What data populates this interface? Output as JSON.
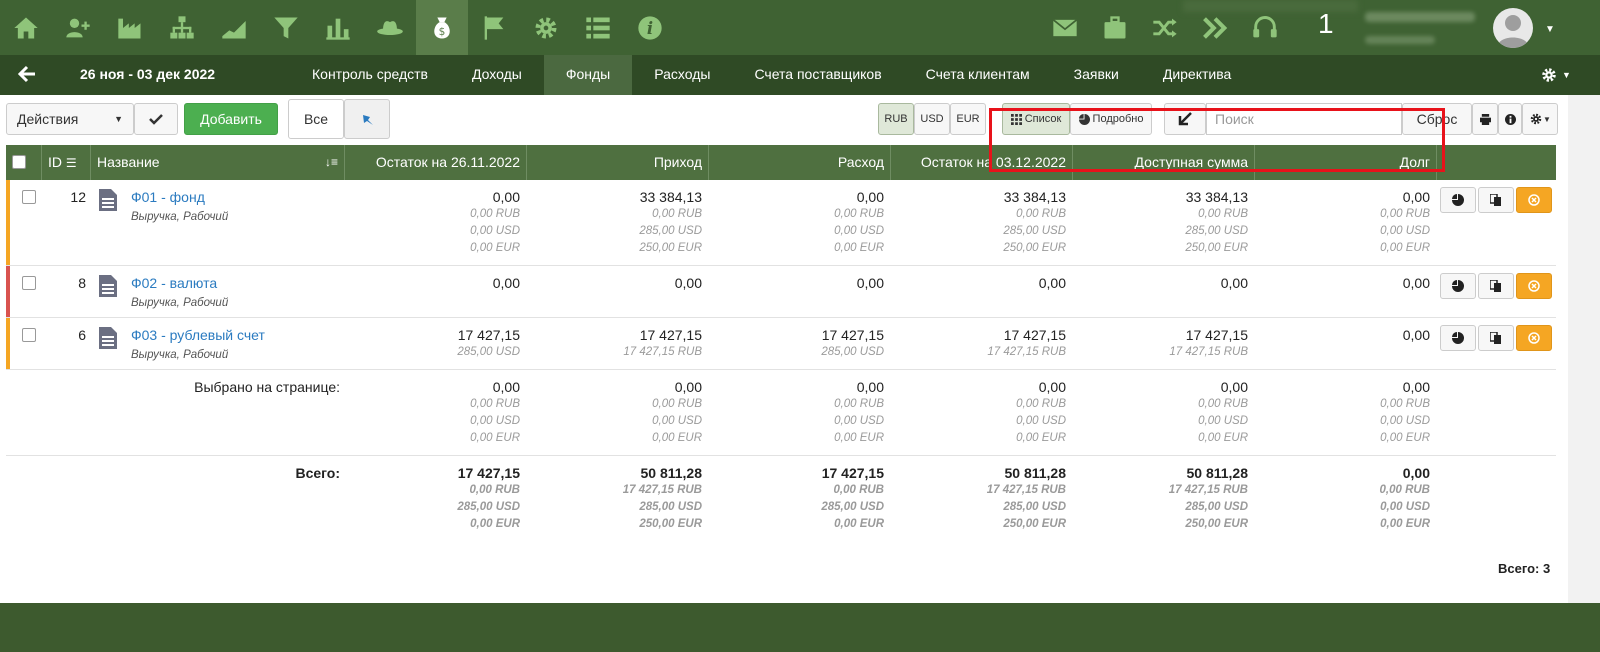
{
  "nav": {
    "badge": "1",
    "date_range": "26 ноя - 03 дек 2022",
    "tabs": [
      "Контроль средств",
      "Доходы",
      "Фонды",
      "Расходы",
      "Счета поставщиков",
      "Счета клиентам",
      "Заявки",
      "Директива"
    ],
    "active_tab": "Фонды"
  },
  "toolbar": {
    "actions_label": "Действия",
    "add_label": "Добавить",
    "filter_all": "Все",
    "currencies": [
      "RUB",
      "USD",
      "EUR"
    ],
    "active_currency": "RUB",
    "view_list": "Список",
    "view_detail": "Подробно",
    "search_placeholder": "Поиск",
    "reset_label": "Сброс"
  },
  "columns": [
    "ID",
    "Название",
    "Остаток на 26.11.2022",
    "Приход",
    "Расход",
    "Остаток на 03.12.2022",
    "Доступная сумма",
    "Долг"
  ],
  "rows": [
    {
      "id": "12",
      "name": "Ф01 - фонд",
      "tags": "Выручка, Рабочий",
      "stripe": "#f5a623",
      "values": [
        {
          "main": "0,00",
          "subs": [
            "0,00 RUB",
            "0,00 USD",
            "0,00 EUR"
          ]
        },
        {
          "main": "33 384,13",
          "subs": [
            "0,00 RUB",
            "285,00 USD",
            "250,00 EUR"
          ]
        },
        {
          "main": "0,00",
          "subs": [
            "0,00 RUB",
            "0,00 USD",
            "0,00 EUR"
          ]
        },
        {
          "main": "33 384,13",
          "subs": [
            "0,00 RUB",
            "285,00 USD",
            "250,00 EUR"
          ]
        },
        {
          "main": "33 384,13",
          "subs": [
            "0,00 RUB",
            "285,00 USD",
            "250,00 EUR"
          ]
        },
        {
          "main": "0,00",
          "subs": [
            "0,00 RUB",
            "0,00 USD",
            "0,00 EUR"
          ]
        }
      ]
    },
    {
      "id": "8",
      "name": "Ф02 - валюта",
      "tags": "Выручка, Рабочий",
      "stripe": "#d9534f",
      "values": [
        {
          "main": "0,00",
          "subs": []
        },
        {
          "main": "0,00",
          "subs": []
        },
        {
          "main": "0,00",
          "subs": []
        },
        {
          "main": "0,00",
          "subs": []
        },
        {
          "main": "0,00",
          "subs": []
        },
        {
          "main": "0,00",
          "subs": []
        }
      ]
    },
    {
      "id": "6",
      "name": "Ф03 - рублевый счет",
      "tags": "Выручка, Рабочий",
      "stripe": "#f5a623",
      "values": [
        {
          "main": "17 427,15",
          "subs": [
            "285,00 USD"
          ]
        },
        {
          "main": "17 427,15",
          "subs": [
            "17 427,15 RUB"
          ]
        },
        {
          "main": "17 427,15",
          "subs": [
            "285,00 USD"
          ]
        },
        {
          "main": "17 427,15",
          "subs": [
            "17 427,15 RUB"
          ]
        },
        {
          "main": "17 427,15",
          "subs": [
            "17 427,15 RUB"
          ]
        },
        {
          "main": "0,00",
          "subs": []
        }
      ]
    }
  ],
  "selected": {
    "label": "Выбрано на странице:",
    "values": [
      {
        "main": "0,00",
        "subs": [
          "0,00 RUB",
          "0,00 USD",
          "0,00 EUR"
        ]
      },
      {
        "main": "0,00",
        "subs": [
          "0,00 RUB",
          "0,00 USD",
          "0,00 EUR"
        ]
      },
      {
        "main": "0,00",
        "subs": [
          "0,00 RUB",
          "0,00 USD",
          "0,00 EUR"
        ]
      },
      {
        "main": "0,00",
        "subs": [
          "0,00 RUB",
          "0,00 USD",
          "0,00 EUR"
        ]
      },
      {
        "main": "0,00",
        "subs": [
          "0,00 RUB",
          "0,00 USD",
          "0,00 EUR"
        ]
      },
      {
        "main": "0,00",
        "subs": [
          "0,00 RUB",
          "0,00 USD",
          "0,00 EUR"
        ]
      }
    ]
  },
  "totals": {
    "label": "Всего:",
    "values": [
      {
        "main": "17 427,15",
        "subs": [
          "0,00 RUB",
          "285,00 USD",
          "0,00 EUR"
        ]
      },
      {
        "main": "50 811,28",
        "subs": [
          "17 427,15 RUB",
          "285,00 USD",
          "250,00 EUR"
        ]
      },
      {
        "main": "17 427,15",
        "subs": [
          "0,00 RUB",
          "285,00 USD",
          "0,00 EUR"
        ]
      },
      {
        "main": "50 811,28",
        "subs": [
          "17 427,15 RUB",
          "285,00 USD",
          "250,00 EUR"
        ]
      },
      {
        "main": "50 811,28",
        "subs": [
          "17 427,15 RUB",
          "285,00 USD",
          "250,00 EUR"
        ]
      },
      {
        "main": "0,00",
        "subs": [
          "0,00 RUB",
          "0,00 USD",
          "0,00 EUR"
        ]
      }
    ]
  },
  "footer": {
    "total_count": "Всего: 3"
  },
  "colors": {
    "link": "#2b7bc0",
    "header": "#4f7040",
    "accent_orange": "#f5a623",
    "highlight": "#e8121a"
  }
}
